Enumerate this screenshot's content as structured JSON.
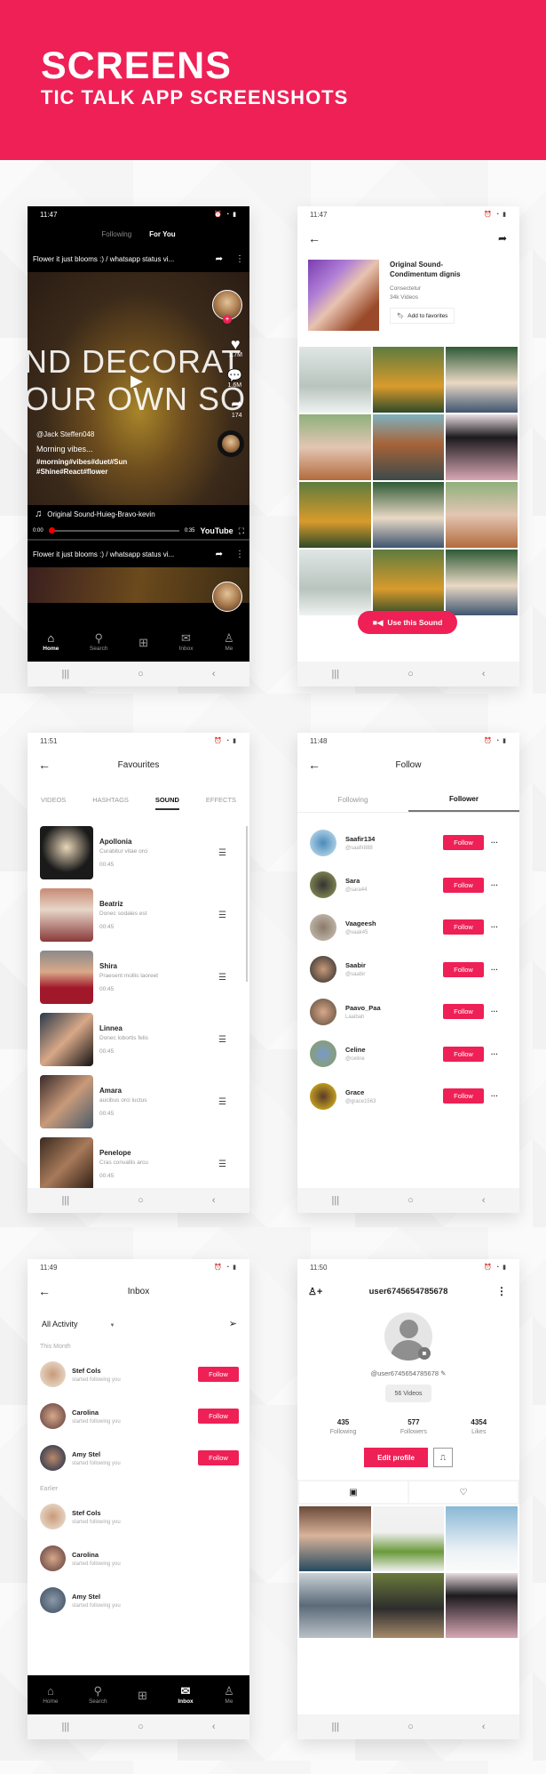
{
  "banner": {
    "title": "SCREENS",
    "subtitle": "TIC TALK APP SCREENSHOTS"
  },
  "accent_color": "#ee2055",
  "screens": {
    "feed": {
      "time": "11:47",
      "tabs": [
        "Following",
        "For You"
      ],
      "active_tab": "For You",
      "video_title": "Flower it just blooms :) / whatsapp status vi...",
      "overlay_text": [
        "ND DECORAT",
        "OUR OWN SO"
      ],
      "likes": "1.7M",
      "comments": "1.6M",
      "shares": "174",
      "username": "@Jack Steffen048",
      "caption": "Morning vibes...",
      "hashtags_1": "#morning#vibes#duet#Sun",
      "hashtags_2": "#Shine#React#flower",
      "sound": "Original Sound-Huieg-Bravo-kevin",
      "time_current": "0:00",
      "time_total": "0:35",
      "progress_fraction": 0.0,
      "youtube_label": "YouTube",
      "next_video_title": "Flower it just blooms :) / whatsapp status vi...",
      "bottom_nav": [
        {
          "label": "Home",
          "icon": "home-icon",
          "glyph": "⌂"
        },
        {
          "label": "Search",
          "icon": "search-icon",
          "glyph": "⚲"
        },
        {
          "label": "",
          "icon": "add-icon",
          "glyph": "⊞"
        },
        {
          "label": "Inbox",
          "icon": "inbox-icon",
          "glyph": "✉"
        },
        {
          "label": "Me",
          "icon": "profile-icon",
          "glyph": "♙"
        }
      ]
    },
    "sound": {
      "time": "11:47",
      "title_line1": "Original Sound-",
      "title_line2": "Condimentum dignis",
      "artist": "Consectetur",
      "videos": "34k Videos",
      "favorite_label": "Add to favorites",
      "use_sound_label": "Use this Sound"
    },
    "favourites": {
      "time": "11:51",
      "title": "Favourites",
      "tabs": [
        "VIDEOS",
        "HASHTAGS",
        "SOUND",
        "EFFECTS"
      ],
      "active_tab": "SOUND",
      "items": [
        {
          "name": "Apollonia",
          "desc": "Curabitur vitae orci",
          "duration": "00:45"
        },
        {
          "name": "Beatriz",
          "desc": "Donec sodales est",
          "duration": "00:45"
        },
        {
          "name": "Shira",
          "desc": "Praesent mollis laoreet",
          "duration": "00:45"
        },
        {
          "name": "Linnea",
          "desc": "Donec lobortis felis",
          "duration": "00:45"
        },
        {
          "name": "Amara",
          "desc": "aucibus orci luctus",
          "duration": "00:45"
        },
        {
          "name": "Penelope",
          "desc": "Cras convallis arcu",
          "duration": "00:45"
        }
      ]
    },
    "follow": {
      "time": "11:48",
      "title": "Follow",
      "tabs": [
        "Following",
        "Follower"
      ],
      "active_tab": "Follower",
      "button_label": "Follow",
      "items": [
        {
          "name": "Saafir134",
          "handle": "@saafir888"
        },
        {
          "name": "Sara",
          "handle": "@sara44"
        },
        {
          "name": "Vaageesh",
          "handle": "@vaak45"
        },
        {
          "name": "Saabir",
          "handle": "@saabir"
        },
        {
          "name": "Paavo_Paa",
          "handle": "Laaibah"
        },
        {
          "name": "Celine",
          "handle": "@celine"
        },
        {
          "name": "Grace",
          "handle": "@grace1563"
        }
      ]
    },
    "inbox": {
      "time": "11:49",
      "title": "Inbox",
      "filter": "All Activity",
      "section_1": "This Month",
      "section_2": "Earlier",
      "button_label": "Follow",
      "this_month": [
        {
          "name": "Stef Cols",
          "text": "started following you"
        },
        {
          "name": "Carolina",
          "text": "started following you"
        },
        {
          "name": "Amy Stel",
          "text": "started following you"
        }
      ],
      "earlier": [
        {
          "name": "Stef Cols",
          "text": "started following you"
        },
        {
          "name": "Carolina",
          "text": "started following you"
        },
        {
          "name": "Amy Stel",
          "text": "started following you"
        }
      ]
    },
    "profile": {
      "time": "11:50",
      "username": "user6745654785678",
      "handle": "@user6745654785678",
      "videos": "56 Videos",
      "following_count": "435",
      "following_label": "Following",
      "followers_count": "577",
      "followers_label": "Followers",
      "likes_count": "4354",
      "likes_label": "Likes",
      "edit_label": "Edit profile"
    }
  }
}
